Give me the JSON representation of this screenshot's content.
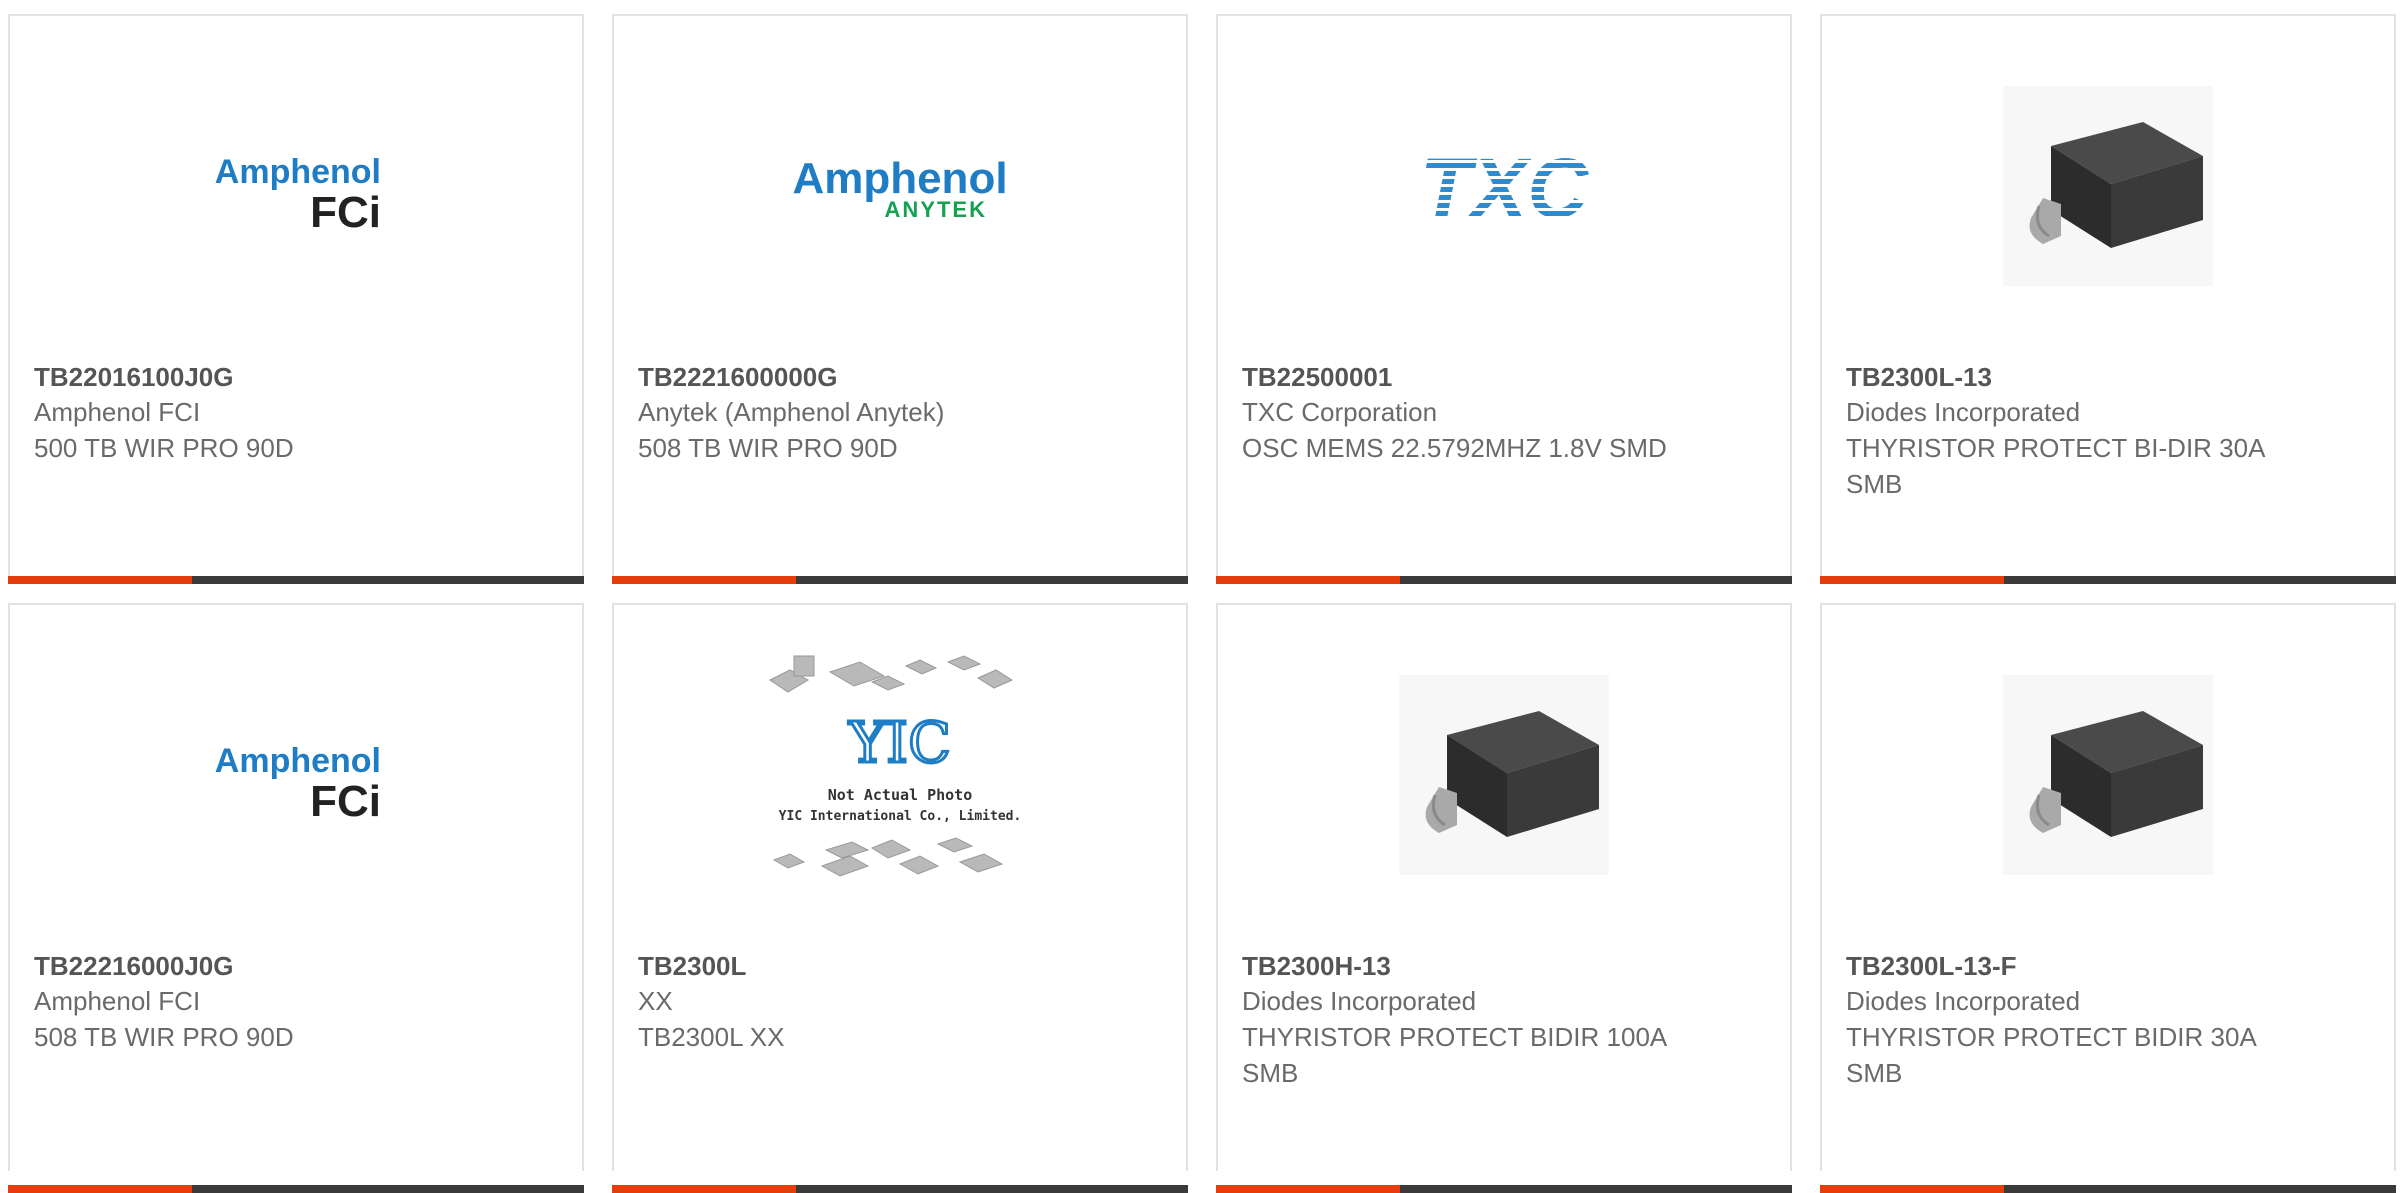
{
  "colors": {
    "accent": "#e53d0c",
    "bar": "#3a3a3a",
    "border": "#e2e2e2"
  },
  "cards": [
    {
      "part": "TB22016100J0G",
      "manufacturer": "Amphenol FCI",
      "description": "500 TB WIR PRO 90D",
      "logo": {
        "line1": "Amphenol",
        "line2": "FCi"
      }
    },
    {
      "part": "TB2221600000G",
      "manufacturer": "Anytek (Amphenol Anytek)",
      "description": "508 TB WIR PRO 90D",
      "logo": {
        "line1": "Amphenol",
        "line2": "ANYTEK"
      }
    },
    {
      "part": "TB22500001",
      "manufacturer": "TXC Corporation",
      "description": "OSC MEMS 22.5792MHZ 1.8V SMD",
      "logo": {
        "line1": "TXC"
      }
    },
    {
      "part": "TB2300L-13",
      "manufacturer": "Diodes Incorporated",
      "description": "THYRISTOR PROTECT BI-DIR 30A SMB",
      "image": "smb-package-icon"
    },
    {
      "part": "TB22216000J0G",
      "manufacturer": "Amphenol FCI",
      "description": "508 TB WIR PRO 90D",
      "logo": {
        "line1": "Amphenol",
        "line2": "FCi"
      }
    },
    {
      "part": "TB2300L",
      "manufacturer": "XX",
      "description": "TB2300L XX",
      "logo": {
        "line1": "Not Actual Photo",
        "line2": "YIC International Co., Limited."
      }
    },
    {
      "part": "TB2300H-13",
      "manufacturer": "Diodes Incorporated",
      "description": "THYRISTOR PROTECT BIDIR 100A SMB",
      "image": "smb-package-icon"
    },
    {
      "part": "TB2300L-13-F",
      "manufacturer": "Diodes Incorporated",
      "description": "THYRISTOR PROTECT BIDIR 30A SMB",
      "image": "smb-package-icon"
    }
  ]
}
